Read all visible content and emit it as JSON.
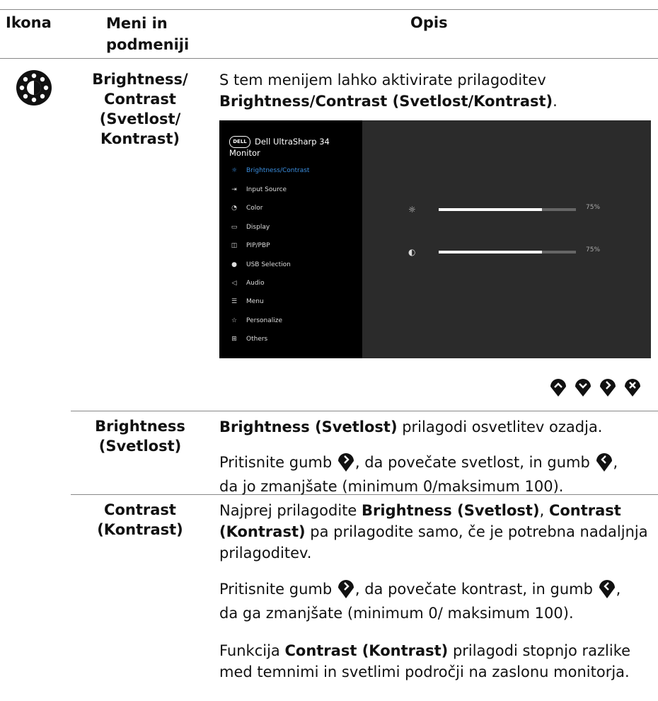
{
  "header": {
    "col_icon": "Ikona",
    "col_menu_l1": "Meni in",
    "col_menu_l2": "podmeniji",
    "col_desc": "Opis"
  },
  "row1": {
    "icon": "brightness-contrast-icon",
    "label_lines": [
      "Brightness/",
      "Contrast",
      "(Svetlost/",
      "Kontrast)"
    ],
    "intro": "S tem menijem lahko aktivirate prilagoditev",
    "intro_bold": "Brightness/Contrast (Svetlost/Kontrast)",
    "intro_end": "."
  },
  "osd": {
    "title": "Dell UltraSharp 34 Monitor",
    "logo_text": "DELL",
    "items": [
      {
        "label": "Brightness/Contrast",
        "icon": "sun-icon",
        "selected": true
      },
      {
        "label": "Input Source",
        "icon": "input-icon"
      },
      {
        "label": "Color",
        "icon": "palette-icon"
      },
      {
        "label": "Display",
        "icon": "monitor-icon"
      },
      {
        "label": "PIP/PBP",
        "icon": "pip-icon"
      },
      {
        "label": "USB Selection",
        "icon": "mouse-icon"
      },
      {
        "label": "Audio",
        "icon": "speaker-icon"
      },
      {
        "label": "Menu",
        "icon": "menu-icon"
      },
      {
        "label": "Personalize",
        "icon": "star-icon"
      },
      {
        "label": "Others",
        "icon": "others-icon"
      }
    ],
    "brightness": {
      "value_text": "75%",
      "level": 0.75
    },
    "contrast": {
      "value_text": "75%",
      "level": 0.75
    }
  },
  "row2": {
    "label_lines": [
      "Brightness",
      "(Svetlost)"
    ],
    "p1_bold": "Brightness (Svetlost)",
    "p1_rest": " prilagodi osvetlitev ozadja.",
    "p2_a": "Pritisnite gumb ",
    "p2_b": ", da povečate svetlost, in gumb ",
    "p2_c": ",",
    "p2_line2": "da jo zmanjšate (minimum 0/maksimum 100)."
  },
  "row3": {
    "label_lines": [
      "Contrast",
      "(Kontrast)"
    ],
    "p1_a": "Najprej prilagodite ",
    "p1_b1": "Brightness (Svetlost)",
    "p1_c": ", ",
    "p1_b2": "Contrast",
    "p1_b3": "(Kontrast)",
    "p1_d": " pa prilagodite samo, če je potrebna nadaljnja",
    "p1_e": "prilagoditev.",
    "p2_a": "Pritisnite gumb ",
    "p2_b": ", da povečate kontrast, in gumb ",
    "p2_c": ",",
    "p2_line2": "da ga zmanjšate (minimum 0/ maksimum 100).",
    "p3_a": "Funkcija ",
    "p3_b": "Contrast (Kontrast)",
    "p3_c": " prilagodi stopnjo razlike",
    "p3_line2": "med temnimi in svetlimi področji na zaslonu monitorja."
  }
}
